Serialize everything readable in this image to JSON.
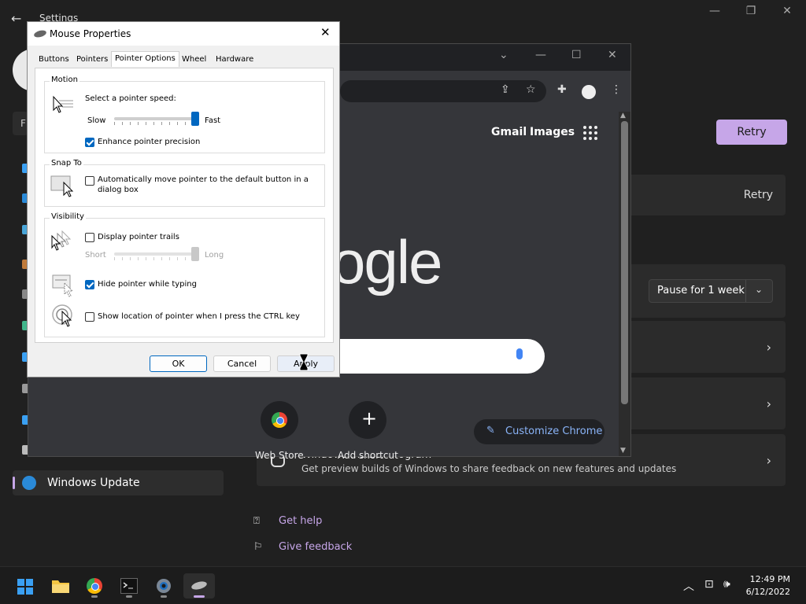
{
  "settings": {
    "title": "Settings",
    "retry_button": "Retry",
    "retry_link": "Retry",
    "pause_select": "Pause for 1 week",
    "active_nav": "Windows Update",
    "search_stub": "F",
    "insider": {
      "title": "Windows Insider Program",
      "subtitle": "Get preview builds of Windows to share feedback on new features and updates"
    },
    "get_help": "Get help",
    "give_feedback": "Give feedback",
    "accent": "#c6a6e8"
  },
  "chrome": {
    "links": {
      "gmail": "Gmail",
      "images": "Images"
    },
    "logo_text": "ogle",
    "shortcuts": [
      {
        "label": "Web Store"
      },
      {
        "label": "Add shortcut"
      }
    ],
    "customize": "Customize Chrome"
  },
  "mouse": {
    "title": "Mouse Properties",
    "tabs": [
      "Buttons",
      "Pointers",
      "Pointer Options",
      "Wheel",
      "Hardware"
    ],
    "active_tab": "Pointer Options",
    "motion": {
      "title": "Motion",
      "speed_label": "Select a pointer speed:",
      "slow": "Slow",
      "fast": "Fast",
      "speed_value": 1.0,
      "enhance": {
        "label": "Enhance pointer precision",
        "checked": true
      }
    },
    "snap": {
      "title": "Snap To",
      "auto_move": {
        "label_line1": "Automatically move pointer to the default button in a",
        "label_line2": "dialog box",
        "checked": false
      }
    },
    "visibility": {
      "title": "Visibility",
      "trails": {
        "label": "Display pointer trails",
        "checked": false
      },
      "short": "Short",
      "long": "Long",
      "trail_value": 1.0,
      "hide_typing": {
        "label": "Hide pointer while typing",
        "checked": true
      },
      "show_ctrl": {
        "label": "Show location of pointer when I press the CTRL key",
        "checked": false
      }
    },
    "buttons": {
      "ok": "OK",
      "cancel": "Cancel",
      "apply": "Apply"
    }
  },
  "taskbar": {
    "apps": [
      "start-icon",
      "file-explorer-icon",
      "chrome-icon",
      "terminal-icon",
      "settings-icon",
      "mouse-properties-icon"
    ],
    "time": "12:49 PM",
    "date": "6/12/2022"
  }
}
